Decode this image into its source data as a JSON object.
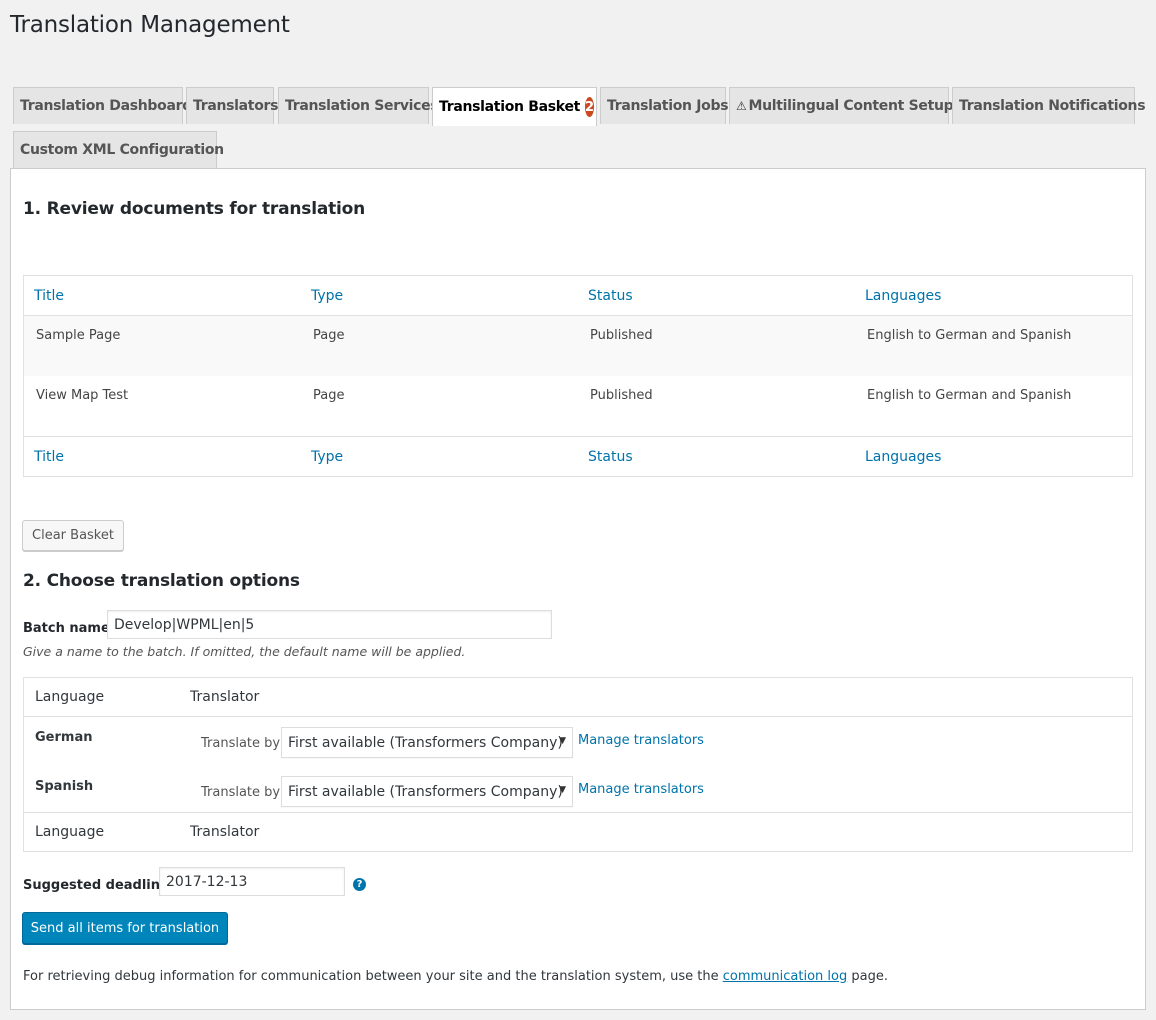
{
  "page": {
    "title": "Translation Management"
  },
  "tabs": [
    {
      "label": "Translation Dashboard"
    },
    {
      "label": "Translators"
    },
    {
      "label": "Translation Services"
    },
    {
      "label": "Translation Basket",
      "badge": "2",
      "active": true
    },
    {
      "label": "Translation Jobs"
    },
    {
      "label": "Multilingual Content Setup",
      "icon": "warning-icon"
    },
    {
      "label": "Translation Notifications"
    },
    {
      "label": "Custom XML Configuration"
    }
  ],
  "review": {
    "title": "1. Review documents for translation",
    "columns": [
      "Title",
      "Type",
      "Status",
      "Languages"
    ],
    "rows": [
      {
        "title": "Sample Page",
        "type": "Page",
        "status": "Published",
        "languages": "English to German and Spanish"
      },
      {
        "title": "View Map Test",
        "type": "Page",
        "status": "Published",
        "languages": "English to German and Spanish"
      }
    ],
    "clear_button": "Clear Basket"
  },
  "options": {
    "title": "2. Choose translation options",
    "batch_label": "Batch name:",
    "batch_value": "Develop|WPML|en|5",
    "batch_hint": "Give a name to the batch. If omitted, the default name will be applied.",
    "lang_columns": [
      "Language",
      "Translator"
    ],
    "languages": [
      {
        "name": "German",
        "translate_by": "Translate by",
        "selected": "First available (Transformers Company)",
        "manage": "Manage translators"
      },
      {
        "name": "Spanish",
        "translate_by": "Translate by",
        "selected": "First available (Transformers Company)",
        "manage": "Manage translators"
      }
    ],
    "deadline_label": "Suggested deadline:",
    "deadline_value": "2017-12-13",
    "help_glyph": "?",
    "send_button": "Send all items for translation"
  },
  "footer": {
    "before": "For retrieving debug information for communication between your site and the translation system, use the ",
    "link": "communication log",
    "after": " page."
  },
  "colors": {
    "accent": "#0073aa",
    "primary_button": "#0085ba",
    "badge": "#ca4a1f"
  }
}
